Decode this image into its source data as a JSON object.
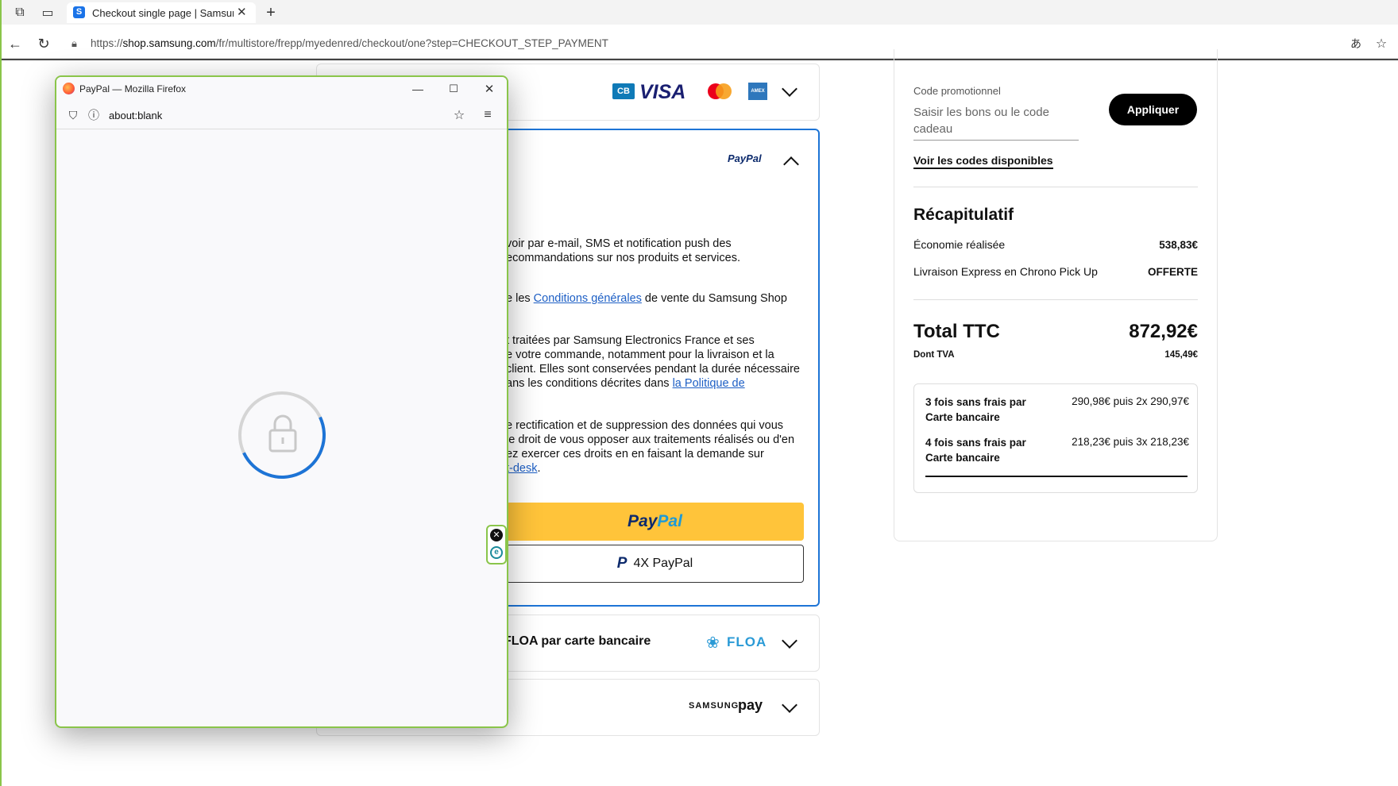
{
  "browser": {
    "tab_title": "Checkout single page | Samsung Fr",
    "favicon_letter": "S",
    "url_prefix": "https://",
    "url_domain": "shop.samsung.com",
    "url_path": "/fr/multistore/frepp/myedenred/checkout/one?step=CHECKOUT_STEP_PAYMENT"
  },
  "payment": {
    "card_brands": [
      "CB",
      "VISA",
      "mastercard",
      "AMEX"
    ],
    "paypal_logo": "PayPal",
    "consent_text_1": "voir par e-mail, SMS et notification push des",
    "consent_text_2": "ecommandations sur nos produits et services.",
    "terms_prefix": "e les ",
    "terms_link": "Conditions générales",
    "terms_suffix": " de vente du Samsung Shop",
    "privacy_1": "t traitées par Samsung Electronics France et ses",
    "privacy_2": "e votre commande, notamment pour la livraison et la",
    "privacy_3": "client. Elles sont conservées pendant la durée nécessaire",
    "privacy_4_prefix": "ans les conditions décrites dans ",
    "privacy_4_link": "la Politique de",
    "rights_1": "e rectification et de suppression des données qui vous",
    "rights_2": "le droit de vous opposer aux traitements réalisés ou d'en",
    "rights_3": "ez exercer ces droits en en faisant la demande sur",
    "rights_4_link": "t-desk",
    "rights_4_suffix": ".",
    "paypal_button_1": "Pay",
    "paypal_button_2": "Pal",
    "paypal4x_button": "4X PayPal",
    "floa_label": "FLOA par carte bancaire",
    "floa_logo": "FLOA",
    "samsungpay_logo_1": "SAMSUNG",
    "samsungpay_logo_2": "pay"
  },
  "summary": {
    "promo_label": "Code promotionnel",
    "promo_placeholder_1": "Saisir les bons ou le code",
    "promo_placeholder_2": "cadeau",
    "apply_button": "Appliquer",
    "codes_link": "Voir les codes disponibles",
    "recap_title": "Récapitulatif",
    "savings_label": "Économie réalisée",
    "savings_value": "538,83€",
    "delivery_label": "Livraison Express en Chrono Pick Up",
    "delivery_value": "OFFERTE",
    "total_label": "Total TTC",
    "total_value": "872,92€",
    "vat_label": "Dont TVA",
    "vat_value": "145,49€",
    "installments": [
      {
        "label_1": "3 fois sans frais par",
        "label_2": "Carte bancaire",
        "value": "290,98€ puis 2x 290,97€"
      },
      {
        "label_1": "4 fois sans frais par",
        "label_2": "Carte bancaire",
        "value": "218,23€ puis 3x 218,23€"
      }
    ]
  },
  "popup": {
    "title": "PayPal — Mozilla Firefox",
    "url": "about:blank"
  },
  "colors": {
    "accent": "#1d74d6",
    "paypal_yellow": "#ffc43a",
    "window_border": "#8ac54a"
  }
}
